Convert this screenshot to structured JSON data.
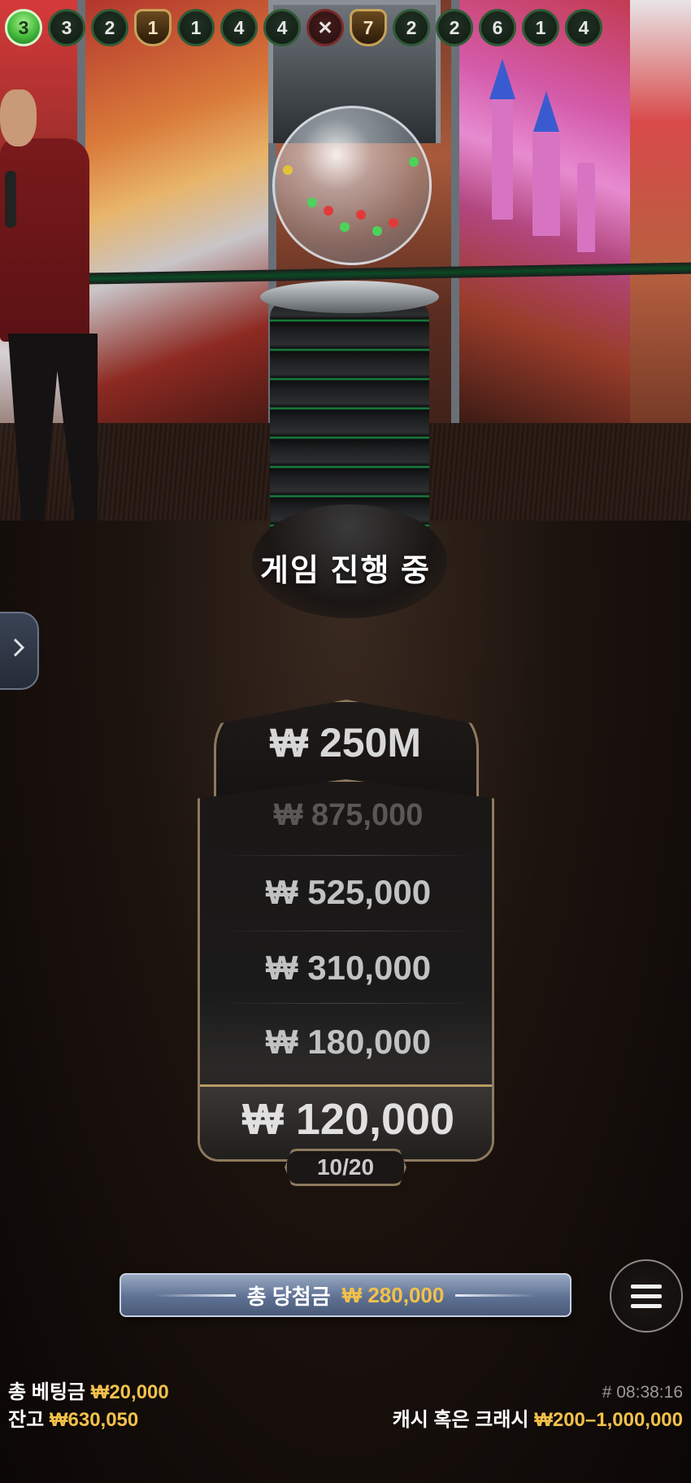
{
  "history": [
    {
      "label": "3",
      "type": "current"
    },
    {
      "label": "3",
      "type": "normal"
    },
    {
      "label": "2",
      "type": "normal"
    },
    {
      "label": "1",
      "type": "shield"
    },
    {
      "label": "1",
      "type": "normal"
    },
    {
      "label": "4",
      "type": "normal"
    },
    {
      "label": "4",
      "type": "normal"
    },
    {
      "label": "✕",
      "type": "cross"
    },
    {
      "label": "7",
      "type": "shield"
    },
    {
      "label": "2",
      "type": "normal"
    },
    {
      "label": "2",
      "type": "normal"
    },
    {
      "label": "6",
      "type": "normal"
    },
    {
      "label": "1",
      "type": "normal"
    },
    {
      "label": "4",
      "type": "normal"
    }
  ],
  "status_text": "게임 진행 중",
  "side_tab_icon": "chevron-right-icon",
  "prize_ladder": {
    "jackpot": "₩ 250M",
    "rows": [
      "₩ 875,000",
      "₩ 525,000",
      "₩ 310,000",
      "₩ 180,000",
      "₩ 120,000"
    ],
    "progress": "10/20"
  },
  "winnings": {
    "label": "총 당첨금",
    "amount": "₩ 280,000"
  },
  "menu_icon": "hamburger-menu-icon",
  "footer": {
    "total_bet_label": "총 베팅금",
    "total_bet_value": "₩20,000",
    "balance_label": "잔고",
    "balance_value": "₩630,050",
    "round_id": "# 08:38:16",
    "bet_limit_label": "캐시 혹은 크래시",
    "bet_limit_value": "₩200–1,000,000"
  },
  "colors": {
    "accent_gold": "#f2c14a",
    "ladder_border": "#8d7a5e",
    "history_current": "#42b83a"
  }
}
